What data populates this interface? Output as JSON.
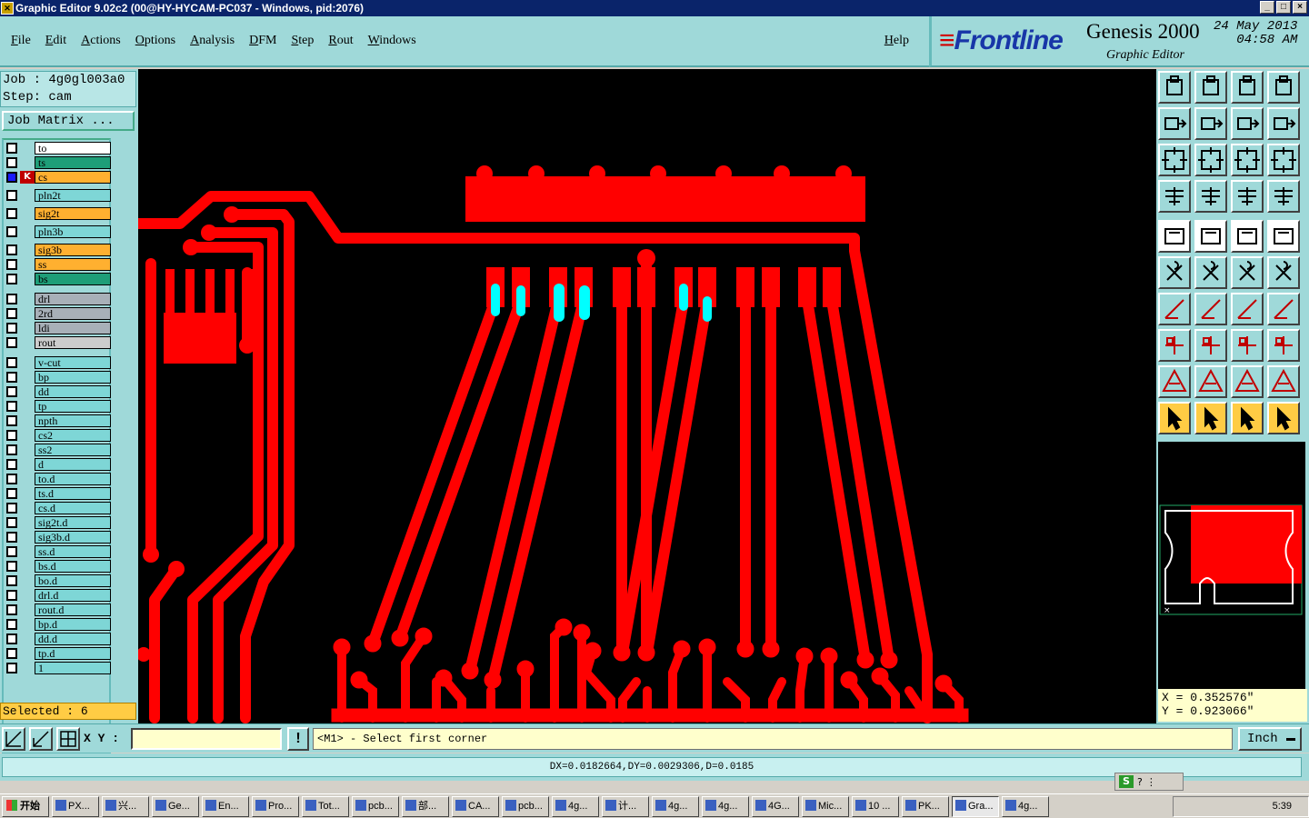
{
  "window": {
    "title": "Graphic Editor 9.02c2 (00@HY-HYCAM-PC037 - Windows, pid:2076)",
    "controls": [
      "_",
      "□",
      "×"
    ]
  },
  "menu": {
    "items": [
      "File",
      "Edit",
      "Actions",
      "Options",
      "Analysis",
      "DFM",
      "Step",
      "Rout",
      "Windows"
    ],
    "help": "Help"
  },
  "brand": {
    "logo": "Frontline",
    "product": "Genesis 2000",
    "date": "24 May 2013",
    "time": "04:58 AM",
    "subtitle": "Graphic Editor"
  },
  "job": {
    "job_line": "Job : 4g0gl003a0",
    "step_line": "Step: cam",
    "matrix_button": "Job Matrix ..."
  },
  "layers": [
    {
      "name": "to",
      "color": "#ffffff",
      "pen": true
    },
    {
      "name": "ts",
      "color": "#1e9e78",
      "pen": true
    },
    {
      "name": "cs",
      "color": "#ffb030",
      "pen": true,
      "active": true
    },
    {
      "name": "pln2t",
      "color": "#7ed6d6",
      "pen": false
    },
    {
      "name": "sig2t",
      "color": "#ffb030",
      "pen": true
    },
    {
      "name": "pln3b",
      "color": "#7ed6d6",
      "pen": false
    },
    {
      "name": "sig3b",
      "color": "#ffb030",
      "pen": true
    },
    {
      "name": "ss",
      "color": "#ffb030",
      "pen": true
    },
    {
      "name": "bs",
      "color": "#1e9e78",
      "pen": true
    },
    {
      "name": "drl",
      "color": "#a8b0b8",
      "pen": false
    },
    {
      "name": "2rd",
      "color": "#a8b0b8",
      "pen": false
    },
    {
      "name": "ldi",
      "color": "#a8b0b8",
      "pen": false
    },
    {
      "name": "rout",
      "color": "#cccccc",
      "pen": false
    },
    {
      "name": "v-cut",
      "color": "#7ed6d6",
      "pen": false
    },
    {
      "name": "bp",
      "color": "#7ed6d6",
      "pen": true
    },
    {
      "name": "dd",
      "color": "#7ed6d6",
      "pen": true
    },
    {
      "name": "tp",
      "color": "#7ed6d6",
      "pen": true
    },
    {
      "name": "npth",
      "color": "#7ed6d6",
      "pen": false
    },
    {
      "name": "cs2",
      "color": "#7ed6d6",
      "pen": false
    },
    {
      "name": "ss2",
      "color": "#7ed6d6",
      "pen": false
    },
    {
      "name": "d",
      "color": "#7ed6d6",
      "pen": false
    },
    {
      "name": "to.d",
      "color": "#7ed6d6",
      "pen": true
    },
    {
      "name": "ts.d",
      "color": "#7ed6d6",
      "pen": true
    },
    {
      "name": "cs.d",
      "color": "#7ed6d6",
      "pen": true
    },
    {
      "name": "sig2t.d",
      "color": "#7ed6d6",
      "pen": true
    },
    {
      "name": "sig3b.d",
      "color": "#7ed6d6",
      "pen": true
    },
    {
      "name": "ss.d",
      "color": "#7ed6d6",
      "pen": true
    },
    {
      "name": "bs.d",
      "color": "#7ed6d6",
      "pen": true
    },
    {
      "name": "bo.d",
      "color": "#7ed6d6",
      "pen": true
    },
    {
      "name": "drl.d",
      "color": "#7ed6d6",
      "pen": true
    },
    {
      "name": "rout.d",
      "color": "#7ed6d6",
      "pen": true
    },
    {
      "name": "bp.d",
      "color": "#7ed6d6",
      "pen": true
    },
    {
      "name": "dd.d",
      "color": "#7ed6d6",
      "pen": true
    },
    {
      "name": "tp.d",
      "color": "#7ed6d6",
      "pen": true
    },
    {
      "name": "1",
      "color": "#7ed6d6",
      "pen": false
    }
  ],
  "selection": {
    "text": "Selected : 6"
  },
  "coords": {
    "x": "X  =  0.352576\"",
    "y": "Y  =  0.923066\""
  },
  "command": {
    "xy_label": "X Y :",
    "xy_value": "",
    "exclaim": "!",
    "prompt": "<M1> - Select first corner",
    "units": "Inch"
  },
  "status": {
    "text": "DX=0.0182664,DY=0.0029306,D=0.0185"
  },
  "colors": {
    "copper": "#ff0000",
    "selected": "#00ffff",
    "canvas": "#000000",
    "panel": "#9fd9d9"
  },
  "tray": {
    "clock": "5:39"
  },
  "taskbar": {
    "start": "开始",
    "tasks": [
      "PX...",
      "兴...",
      "Ge...",
      "En...",
      "Pro...",
      "Tot...",
      "pcb...",
      "部...",
      "CA...",
      "pcb...",
      "4g...",
      "计...",
      "4g...",
      "4g...",
      "4G...",
      "Mic...",
      "10 ...",
      "PK...",
      "Gra...",
      "4g..."
    ],
    "active_task": "Gra..."
  }
}
